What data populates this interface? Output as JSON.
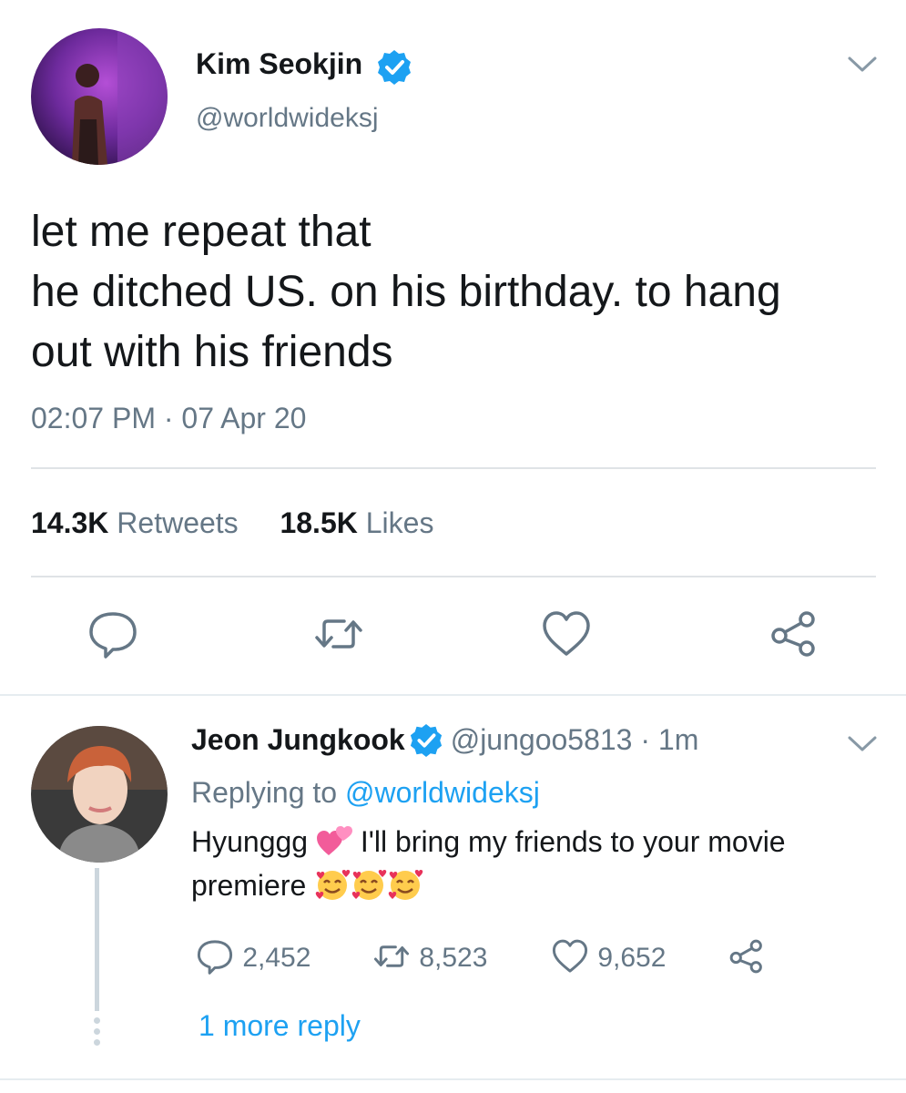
{
  "tweet": {
    "author_name": "Kim Seokjin",
    "author_handle": "@worldwideksj",
    "text_lines": [
      "let me repeat that",
      "he ditched US. on his birthday. to hang",
      "out with his friends"
    ],
    "timestamp": "02:07 PM · 07 Apr 20",
    "retweets_count": "14.3K",
    "retweets_label": "Retweets",
    "likes_count": "18.5K",
    "likes_label": "Likes"
  },
  "reply": {
    "author_name": "Jeon Jungkook",
    "author_handle": "@jungoo5813",
    "time_ago": "1m",
    "replying_prefix": "Replying to",
    "replying_handle": "@worldwideksj",
    "text_line1_a": "Hyunggg",
    "text_line1_b": "I'll bring my friends to your movie",
    "text_line2": "premiere",
    "reply_count": "2,452",
    "retweet_count": "8,523",
    "like_count": "9,652"
  },
  "more_replies_label": "1 more reply",
  "colors": {
    "accent": "#1da1f2",
    "secondary_text": "#657786",
    "primary_text": "#14171a"
  },
  "icons": [
    "verified-badge-icon",
    "chevron-down-icon",
    "reply-icon",
    "retweet-icon",
    "like-icon",
    "share-icon",
    "two-hearts-emoji",
    "smiling-face-with-hearts-emoji"
  ]
}
